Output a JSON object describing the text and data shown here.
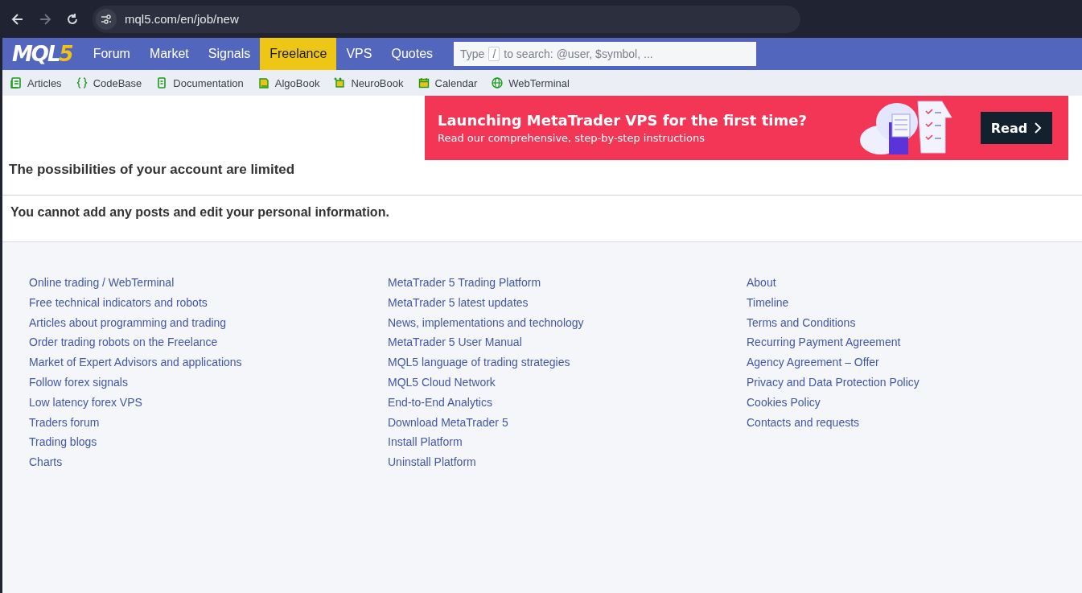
{
  "browser": {
    "url": "mql5.com/en/job/new"
  },
  "nav": {
    "logo": {
      "text": "MQL",
      "accent": "5"
    },
    "tabs": [
      {
        "label": "Forum",
        "selected": false
      },
      {
        "label": "Market",
        "selected": false
      },
      {
        "label": "Signals",
        "selected": false
      },
      {
        "label": "Freelance",
        "selected": true
      },
      {
        "label": "VPS",
        "selected": false
      },
      {
        "label": "Quotes",
        "selected": false
      }
    ],
    "search": {
      "placeholder_before": "Type",
      "key": "/",
      "placeholder_after": "to search: @user, $symbol, ..."
    }
  },
  "subnav": [
    {
      "kind": "articles",
      "label": "Articles"
    },
    {
      "kind": "codebase",
      "label": "CodeBase"
    },
    {
      "kind": "documentation",
      "label": "Documentation"
    },
    {
      "kind": "algobook",
      "label": "AlgoBook"
    },
    {
      "kind": "neurobook",
      "label": "NeuroBook"
    },
    {
      "kind": "calendar",
      "label": "Calendar"
    },
    {
      "kind": "webterminal",
      "label": "WebTerminal"
    }
  ],
  "banner": {
    "title": "Launching MetaTrader VPS for the first time?",
    "subtitle": "Read our comprehensive, step-by-step instructions",
    "button": "Read"
  },
  "heading": "The possibilities of your account are limited",
  "notice": "You cannot add any posts and edit your personal information.",
  "footer": {
    "columns": [
      [
        "Online trading / WebTerminal",
        "Free technical indicators and robots",
        "Articles about programming and trading",
        "Order trading robots on the Freelance",
        "Market of Expert Advisors and applications",
        "Follow forex signals",
        "Low latency forex VPS",
        "Traders forum",
        "Trading blogs",
        "Charts"
      ],
      [
        "MetaTrader 5 Trading Platform",
        "MetaTrader 5 latest updates",
        "News, implementations and technology",
        "MetaTrader 5 User Manual",
        "MQL5 language of trading strategies",
        "MQL5 Cloud Network",
        "End-to-End Analytics",
        "Download MetaTrader 5",
        "Install Platform",
        "Uninstall Platform"
      ],
      [
        "About",
        "Timeline",
        "Terms and Conditions",
        "Recurring Payment Agreement",
        "Agency Agreement – Offer",
        "Privacy and Data Protection Policy",
        "Cookies Policy",
        "Contacts and requests"
      ]
    ]
  }
}
